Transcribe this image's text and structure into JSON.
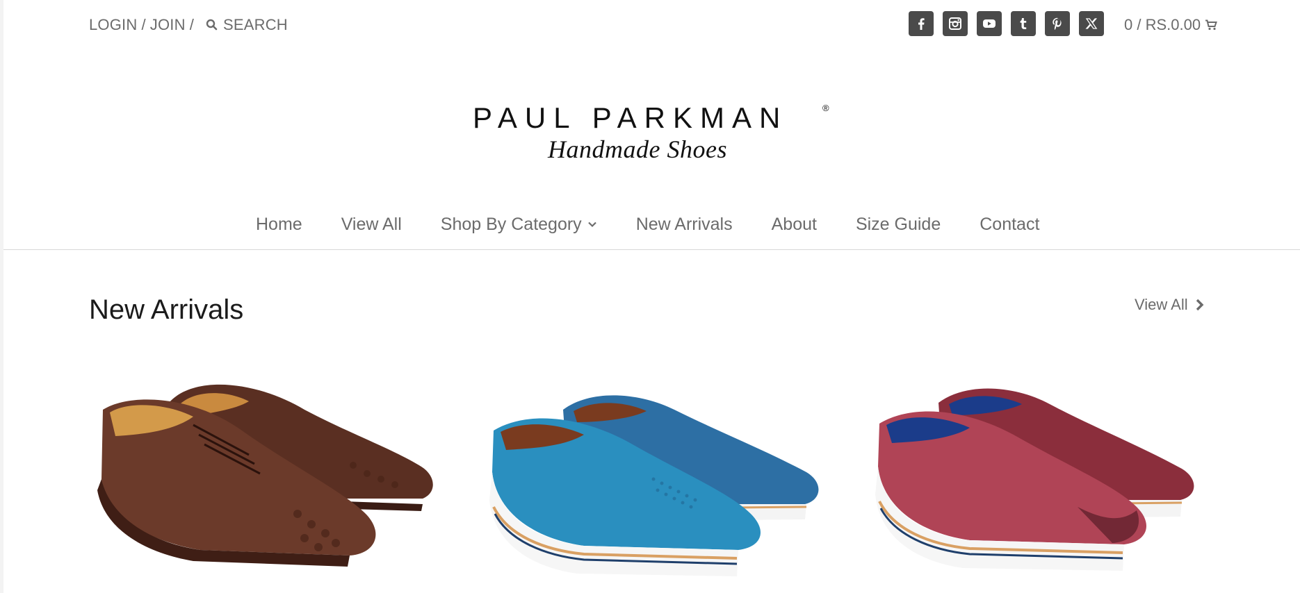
{
  "topbar": {
    "login": "LOGIN",
    "join": "JOIN",
    "search": "SEARCH"
  },
  "socials": [
    {
      "icon": "facebook-icon"
    },
    {
      "icon": "instagram-icon"
    },
    {
      "icon": "youtube-icon"
    },
    {
      "icon": "tumblr-icon"
    },
    {
      "icon": "pinterest-icon"
    },
    {
      "icon": "x-twitter-icon"
    }
  ],
  "cart": {
    "label": "0 / RS.0.00",
    "icon": "cart-icon"
  },
  "logo": {
    "brand": "PAUL PARKMAN",
    "registered": "®",
    "tagline": "Handmade Shoes"
  },
  "nav": {
    "items": [
      "Home",
      "View All",
      "Shop By Category",
      "New Arrivals",
      "About",
      "Size Guide",
      "Contact"
    ]
  },
  "section": {
    "title": "New Arrivals",
    "view_all": "View All"
  },
  "products": [
    {
      "image": "brown-ostrich-oxford-shoes"
    },
    {
      "image": "turquoise-perforated-loafers"
    },
    {
      "image": "burgundy-perforated-loafers"
    }
  ],
  "colors": {
    "social_bg": "#4a4a4a",
    "text_muted": "#6b6b6b",
    "heading": "#1b1b1b",
    "divider": "#d8d8d8"
  }
}
